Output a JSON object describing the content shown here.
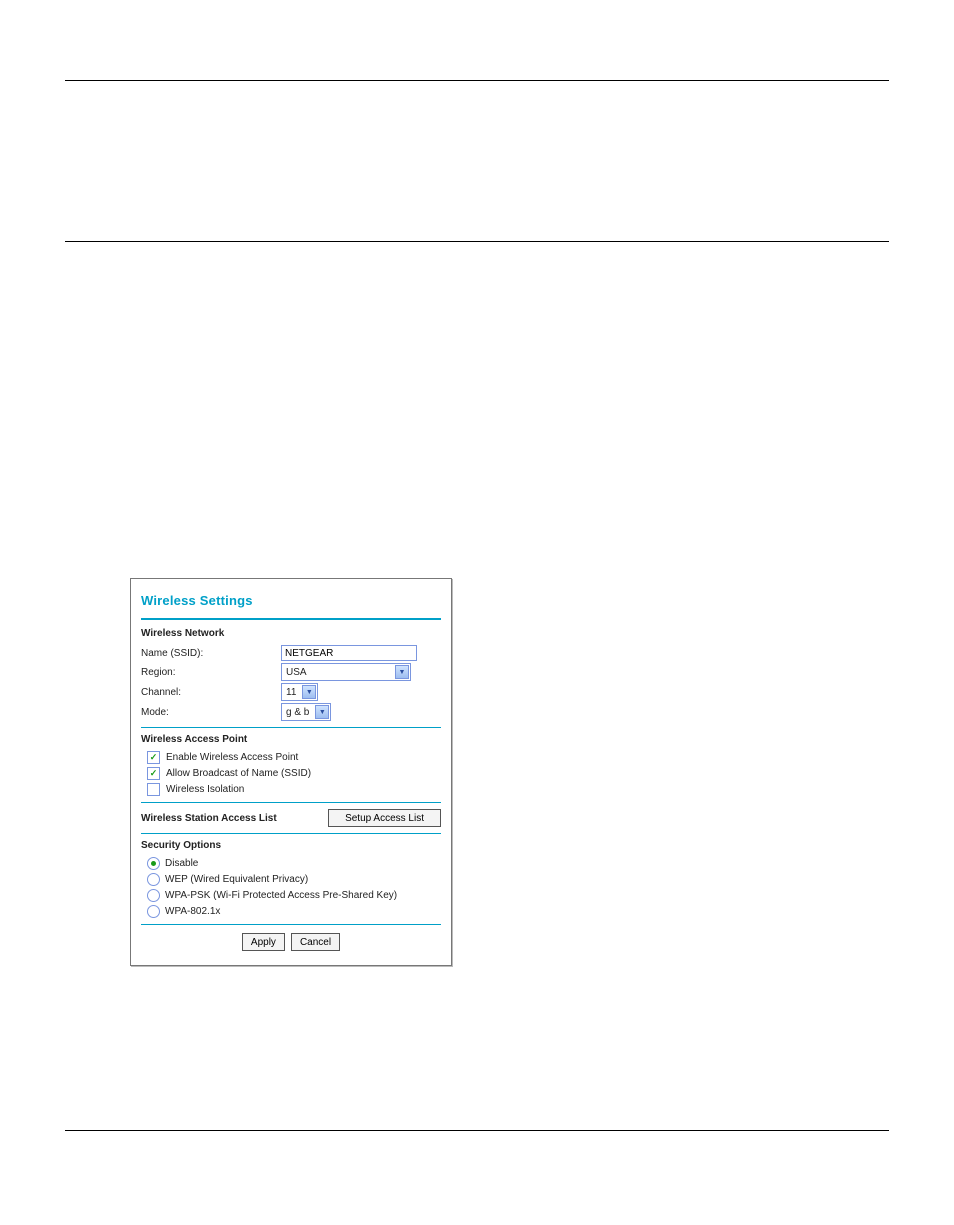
{
  "panel": {
    "title": "Wireless Settings",
    "network": {
      "heading": "Wireless Network",
      "name_label": "Name (SSID):",
      "name_value": "NETGEAR",
      "region_label": "Region:",
      "region_value": "USA",
      "channel_label": "Channel:",
      "channel_value": "11",
      "mode_label": "Mode:",
      "mode_value": "g & b"
    },
    "ap": {
      "heading": "Wireless Access Point",
      "enable_label": "Enable Wireless Access Point",
      "broadcast_label": "Allow Broadcast of Name (SSID)",
      "isolation_label": "Wireless Isolation"
    },
    "access_list": {
      "label": "Wireless Station Access List",
      "button": "Setup Access List"
    },
    "security": {
      "heading": "Security Options",
      "opt_disable": "Disable",
      "opt_wep": "WEP (Wired Equivalent Privacy)",
      "opt_wpapsk": "WPA-PSK (Wi-Fi Protected Access Pre-Shared Key)",
      "opt_wpa8021x": "WPA-802.1x"
    },
    "buttons": {
      "apply": "Apply",
      "cancel": "Cancel"
    }
  }
}
